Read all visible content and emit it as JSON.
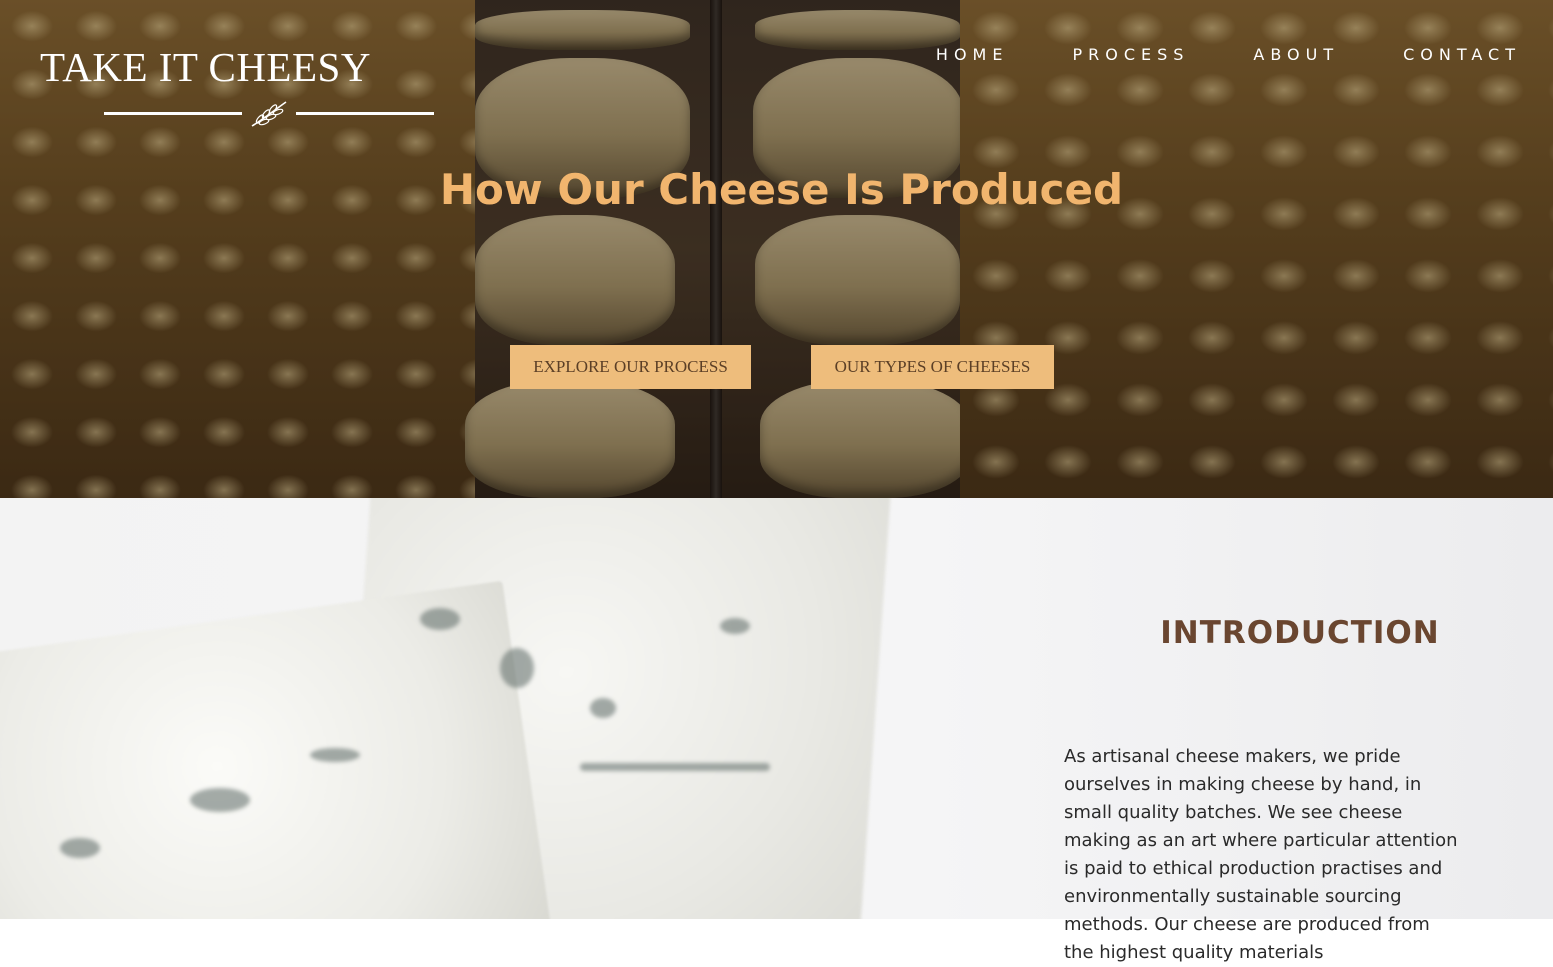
{
  "brand": {
    "name": "TAKE IT CHEESY"
  },
  "nav": {
    "items": [
      {
        "label": "HOME"
      },
      {
        "label": "PROCESS"
      },
      {
        "label": "ABOUT"
      },
      {
        "label": "CONTACT"
      }
    ]
  },
  "hero": {
    "title": "How Our Cheese Is Produced",
    "buttons": {
      "explore": "EXPLORE OUR PROCESS",
      "types": "OUR TYPES OF CHEESES"
    }
  },
  "intro": {
    "title": "INTRODUCTION",
    "body": "As artisanal cheese makers, we pride ourselves in making cheese by hand, in small quality batches. We see cheese making as an art where particular attention is paid to ethical production practises and environmentally sustainable sourcing methods. Our cheese are produced from the highest quality materials"
  },
  "colors": {
    "accent": "#f1b56e",
    "button_bg": "#eebd7c",
    "button_text": "#5b3f26",
    "heading_brown": "#6a4630"
  },
  "icons": {
    "logo_ornament": "laurel-branch-icon"
  }
}
